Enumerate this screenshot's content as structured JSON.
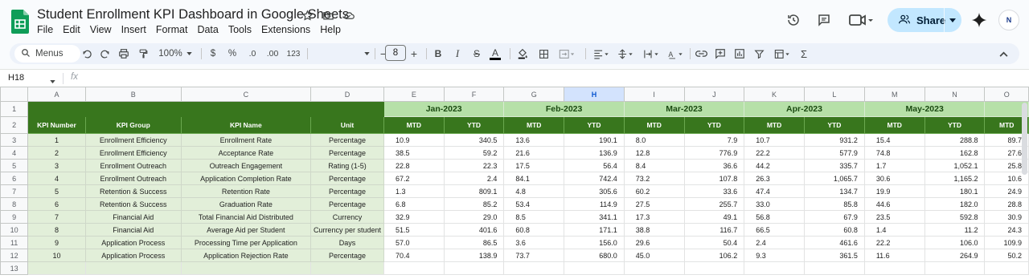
{
  "doc": {
    "title": "Student Enrollment KPI Dashboard in Google Sheets",
    "menu": [
      "File",
      "Edit",
      "View",
      "Insert",
      "Format",
      "Data",
      "Tools",
      "Extensions",
      "Help"
    ]
  },
  "header": {
    "share_label": "Share",
    "avatar_text": "N"
  },
  "toolbar": {
    "menus_label": "Menus",
    "zoom": "100%",
    "currency": "$",
    "percent": "%",
    "dec_decrease": ".0",
    "dec_increase": ".00",
    "number_format": "123",
    "font_size": "8"
  },
  "formula_bar": {
    "cell_ref": "H18",
    "fx": "fx"
  },
  "grid": {
    "column_letters": [
      "A",
      "B",
      "C",
      "D",
      "E",
      "F",
      "G",
      "H",
      "I",
      "J",
      "K",
      "L",
      "M",
      "N",
      "O"
    ],
    "row_numbers": [
      "1",
      "2",
      "3",
      "4",
      "5",
      "6",
      "7",
      "8",
      "9",
      "10",
      "11",
      "12",
      "13"
    ],
    "months": [
      "Jan-2023",
      "Feb-2023",
      "Mar-2023",
      "Apr-2023",
      "May-2023"
    ],
    "headers": [
      "KPI Number",
      "KPI Group",
      "KPI Name",
      "Unit"
    ],
    "mtd": "MTD",
    "ytd": "YTD",
    "last_col_label": "MTD",
    "rows": [
      {
        "num": "1",
        "group": "Enrollment Efficiency",
        "name": "Enrollment Rate",
        "unit": "Percentage",
        "vals": [
          "10.9",
          "340.5",
          "13.6",
          "190.1",
          "8.0",
          "7.9",
          "10.7",
          "931.2",
          "15.4",
          "288.8",
          "89.7"
        ]
      },
      {
        "num": "2",
        "group": "Enrollment Efficiency",
        "name": "Acceptance Rate",
        "unit": "Percentage",
        "vals": [
          "38.5",
          "59.2",
          "21.6",
          "136.9",
          "12.8",
          "776.9",
          "22.2",
          "577.9",
          "74.8",
          "162.8",
          "27.6"
        ]
      },
      {
        "num": "3",
        "group": "Enrollment Outreach",
        "name": "Outreach Engagement",
        "unit": "Rating (1-5)",
        "vals": [
          "22.8",
          "22.3",
          "17.5",
          "56.4",
          "8.4",
          "36.6",
          "44.2",
          "335.7",
          "1.7",
          "1,052.1",
          "25.8"
        ]
      },
      {
        "num": "4",
        "group": "Enrollment Outreach",
        "name": "Application Completion Rate",
        "unit": "Percentage",
        "vals": [
          "67.2",
          "2.4",
          "84.1",
          "742.4",
          "73.2",
          "107.8",
          "26.3",
          "1,065.7",
          "30.6",
          "1,165.2",
          "10.6"
        ]
      },
      {
        "num": "5",
        "group": "Retention & Success",
        "name": "Retention Rate",
        "unit": "Percentage",
        "vals": [
          "1.3",
          "809.1",
          "4.8",
          "305.6",
          "60.2",
          "33.6",
          "47.4",
          "134.7",
          "19.9",
          "180.1",
          "24.9"
        ]
      },
      {
        "num": "6",
        "group": "Retention & Success",
        "name": "Graduation Rate",
        "unit": "Percentage",
        "vals": [
          "6.8",
          "85.2",
          "53.4",
          "114.9",
          "27.5",
          "255.7",
          "33.0",
          "85.8",
          "44.6",
          "182.0",
          "28.8"
        ]
      },
      {
        "num": "7",
        "group": "Financial Aid",
        "name": "Total Financial Aid Distributed",
        "unit": "Currency",
        "vals": [
          "32.9",
          "29.0",
          "8.5",
          "341.1",
          "17.3",
          "49.1",
          "56.8",
          "67.9",
          "23.5",
          "592.8",
          "30.9"
        ]
      },
      {
        "num": "8",
        "group": "Financial Aid",
        "name": "Average Aid per Student",
        "unit": "Currency per student",
        "vals": [
          "51.5",
          "401.6",
          "60.8",
          "171.1",
          "38.8",
          "116.7",
          "66.5",
          "60.8",
          "1.4",
          "11.2",
          "24.3"
        ]
      },
      {
        "num": "9",
        "group": "Application Process",
        "name": "Processing Time per Application",
        "unit": "Days",
        "vals": [
          "57.0",
          "86.5",
          "3.6",
          "156.0",
          "29.6",
          "50.4",
          "2.4",
          "461.6",
          "22.2",
          "106.0",
          "109.9"
        ]
      },
      {
        "num": "10",
        "group": "Application Process",
        "name": "Application Rejection Rate",
        "unit": "Percentage",
        "vals": [
          "70.4",
          "138.9",
          "73.7",
          "680.0",
          "45.0",
          "106.2",
          "9.3",
          "361.5",
          "11.6",
          "264.9",
          "50.2"
        ]
      }
    ]
  },
  "colors": {
    "header_dark_green": "#38761d",
    "month_light_green": "#b6e0a8",
    "info_fill": "#e2efd9",
    "share_bg": "#c2e7ff",
    "selected_col": "#d3e3fd"
  }
}
